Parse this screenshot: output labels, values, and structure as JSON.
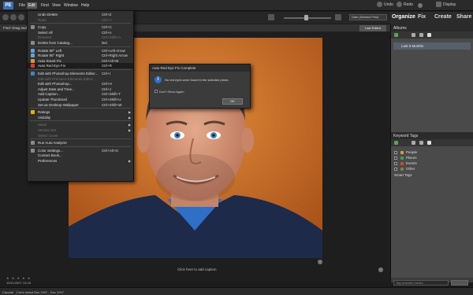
{
  "menubar": {
    "logo": "PE",
    "items": [
      "File",
      "Edit",
      "Find",
      "View",
      "Window",
      "Help"
    ],
    "active_index": 1,
    "undo": "Undo",
    "redo": "Redo",
    "display": "Display"
  },
  "toolbar": {
    "date_select": "Date (Newest First)",
    "find_text": "Find: Drag and drop photos",
    "sort_button": "Last Edited"
  },
  "tabs": [
    "Organize",
    "Fix",
    "Create",
    "Share"
  ],
  "edit_menu": [
    {
      "label": "Undo Delete",
      "shortcut": "Ctrl+Z"
    },
    {
      "label": "Redo",
      "shortcut": "Ctrl+Y",
      "disabled": true
    },
    {
      "sep": true
    },
    {
      "label": "Copy",
      "shortcut": "Ctrl+C"
    },
    {
      "label": "Select All",
      "shortcut": "Ctrl+A"
    },
    {
      "label": "Deselect",
      "shortcut": "Ctrl+Shift+A",
      "disabled": true
    },
    {
      "label": "Delete from Catalog...",
      "shortcut": "Del"
    },
    {
      "sep": true
    },
    {
      "label": "Rotate 90° Left",
      "shortcut": "Ctrl+Left Arrow"
    },
    {
      "label": "Rotate 90° Right",
      "shortcut": "Ctrl+Right Arrow"
    },
    {
      "label": "Auto Smart Fix",
      "shortcut": "Ctrl+Alt+M"
    },
    {
      "label": "Auto Red Eye Fix",
      "shortcut": "Ctrl+R",
      "highlight": true
    },
    {
      "sep": true
    },
    {
      "label": "Edit with Photoshop Elements Editor...",
      "shortcut": "Ctrl+I"
    },
    {
      "label": "Edit with Premiere Elements Editor...",
      "shortcut": "",
      "disabled": true
    },
    {
      "label": "Edit with Photoshop...",
      "shortcut": "Ctrl+H"
    },
    {
      "label": "Adjust Date and Time...",
      "shortcut": "Ctrl+J"
    },
    {
      "label": "Add Caption...",
      "shortcut": "Ctrl+Shift+T"
    },
    {
      "label": "Update Thumbnail",
      "shortcut": "Ctrl+Shift+U"
    },
    {
      "label": "Set as Desktop Wallpaper",
      "shortcut": "Ctrl+Shift+W"
    },
    {
      "sep": true
    },
    {
      "label": "Ratings",
      "shortcut": "",
      "submenu": true
    },
    {
      "label": "Visibility",
      "shortcut": "",
      "submenu": true
    },
    {
      "sep": true
    },
    {
      "label": "Stack",
      "shortcut": "",
      "submenu": true,
      "disabled": true
    },
    {
      "label": "Version Set",
      "shortcut": "",
      "submenu": true,
      "disabled": true
    },
    {
      "label": "Select Cover",
      "shortcut": "",
      "disabled": true
    },
    {
      "sep": true
    },
    {
      "label": "Run Auto Analyzer",
      "shortcut": ""
    },
    {
      "sep": true
    },
    {
      "label": "Color Settings...",
      "shortcut": "Ctrl+Alt+G"
    },
    {
      "label": "Contact Book...",
      "shortcut": ""
    },
    {
      "label": "Preferences",
      "shortcut": "",
      "submenu": true
    }
  ],
  "dialog": {
    "title": "Auto Red Eye Fix Complete",
    "message": "No red eyes were found in the selected photo.",
    "checkbox": "Don't Show Again",
    "ok": "OK"
  },
  "main": {
    "caption_hint": "Click here to add caption",
    "stars": "★ ★ ★ ★ ★",
    "date": "10/11/2007 13:18"
  },
  "right_panel": {
    "albums_title": "Albums",
    "album_item": "Last 6 Months",
    "keyword_title": "Keyword Tags",
    "keywords": [
      {
        "label": "People",
        "color": "#c8a14a"
      },
      {
        "label": "Places",
        "color": "#4a9a5a"
      },
      {
        "label": "Events",
        "color": "#c0503a"
      },
      {
        "label": "Other",
        "color": "#8a7a4a"
      }
    ],
    "smart_tags": "Smart Tags",
    "tag_input": "Tag selected media"
  },
  "status": {
    "left": "Canada",
    "text": "1 item dated Dec 2007 - Dec 2007"
  },
  "colors": {
    "menu_bg": "#303030",
    "highlight": "#1d1d1d",
    "photo_bg": "#c46a21",
    "accent_blue": "#2f6fc7"
  }
}
